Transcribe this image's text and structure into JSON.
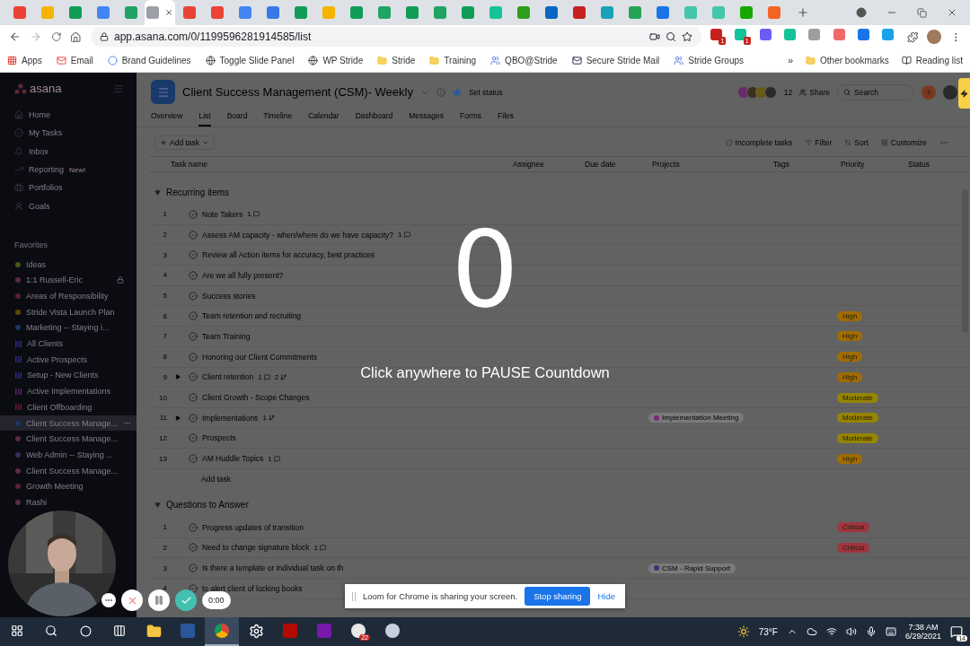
{
  "browser": {
    "tabs": [
      {
        "color": "#ea4335",
        "selected": false
      },
      {
        "color": "#f4b400",
        "selected": false
      },
      {
        "color": "#0f9d58",
        "selected": false
      },
      {
        "color": "#4285f4",
        "selected": false
      },
      {
        "color": "#1ea362",
        "selected": false
      },
      {
        "color": "#9aa0a6",
        "selected": true
      },
      {
        "color": "#ea4335",
        "selected": false
      },
      {
        "color": "#ea4335",
        "selected": false
      },
      {
        "color": "#4285f4",
        "selected": false
      },
      {
        "color": "#3b78e7",
        "selected": false
      },
      {
        "color": "#0f9d58",
        "selected": false
      },
      {
        "color": "#f4b400",
        "selected": false
      },
      {
        "color": "#0f9d58",
        "selected": false
      },
      {
        "color": "#1fa463",
        "selected": false
      },
      {
        "color": "#0f9d58",
        "selected": false
      },
      {
        "color": "#1fa463",
        "selected": false
      },
      {
        "color": "#0f9d58",
        "selected": false
      },
      {
        "color": "#15c39a",
        "selected": false
      },
      {
        "color": "#2ca01c",
        "selected": false
      },
      {
        "color": "#0a66c2",
        "selected": false
      },
      {
        "color": "#c5221f",
        "selected": false
      },
      {
        "color": "#1aa3b8",
        "selected": false
      },
      {
        "color": "#23a455",
        "selected": false
      },
      {
        "color": "#1a73e8",
        "selected": false
      },
      {
        "color": "#43c6ac",
        "selected": false
      },
      {
        "color": "#43c6ac",
        "selected": false
      },
      {
        "color": "#14a800",
        "selected": false
      },
      {
        "color": "#f26522",
        "selected": false
      }
    ],
    "url": "app.asana.com/0/1199596281914585/list",
    "extensions": [
      {
        "color": "#c5221f",
        "badge": "1"
      },
      {
        "color": "#15c39a",
        "badge": "1"
      },
      {
        "color": "#6b5cf5"
      },
      {
        "color": "#15c39a"
      },
      {
        "color": "#9e9e9e"
      },
      {
        "color": "#f06a6a"
      },
      {
        "color": "#1a73e8"
      },
      {
        "color": "#1aa3e8"
      }
    ],
    "bookmarks": [
      {
        "label": "Apps",
        "kind": "apps"
      },
      {
        "label": "Email",
        "kind": "gmail"
      },
      {
        "label": "Brand Guidelines",
        "kind": "google"
      },
      {
        "label": "Toggle Slide Panel",
        "kind": "globe"
      },
      {
        "label": "WP Stride",
        "kind": "globe"
      },
      {
        "label": "Stride",
        "kind": "folder"
      },
      {
        "label": "Training",
        "kind": "folder"
      },
      {
        "label": "QBO@Stride",
        "kind": "groups"
      },
      {
        "label": "Secure Stride Mail",
        "kind": "mail"
      },
      {
        "label": "Stride Groups",
        "kind": "groups"
      }
    ],
    "overflow": "»",
    "other_bookmarks": "Other bookmarks",
    "reading_list": "Reading list"
  },
  "sidebar": {
    "logo": "asana",
    "nav": [
      {
        "label": "Home",
        "kind": "home"
      },
      {
        "label": "My Tasks",
        "kind": "tasks"
      },
      {
        "label": "Inbox",
        "kind": "inbox"
      },
      {
        "label": "Reporting",
        "kind": "reporting",
        "badge": "New!"
      },
      {
        "label": "Portfolios",
        "kind": "portfolios"
      },
      {
        "label": "Goals",
        "kind": "goals"
      }
    ],
    "favorites_title": "Favorites",
    "projects": [
      {
        "label": "Ideas",
        "kind": "dot",
        "color": "#3f5a1c",
        "selected": false,
        "locked": false
      },
      {
        "label": "1:1 Russell-Eric",
        "kind": "dot",
        "color": "#5a2a4a",
        "selected": false,
        "locked": true
      },
      {
        "label": "Areas of Responsibility",
        "kind": "dot",
        "color": "#5a2035",
        "selected": false,
        "locked": false
      },
      {
        "label": "Stride Vista Launch Plan",
        "kind": "dot",
        "color": "#5a4a10",
        "selected": false,
        "locked": false
      },
      {
        "label": "Marketing -- Staying i...",
        "kind": "dot",
        "color": "#1a3560",
        "selected": false,
        "locked": false
      },
      {
        "label": "All Clients",
        "kind": "bars",
        "color": "#2a3070",
        "selected": false,
        "locked": false
      },
      {
        "label": "Active Prospects",
        "kind": "bars",
        "color": "#2a3070",
        "selected": false,
        "locked": false
      },
      {
        "label": "Setup - New Clients",
        "kind": "bars",
        "color": "#2a3070",
        "selected": false,
        "locked": false
      },
      {
        "label": "Active Implementations",
        "kind": "bars",
        "color": "#4a2a5a",
        "selected": false,
        "locked": false
      },
      {
        "label": "Client Offboarding",
        "kind": "bars",
        "color": "#5a2030",
        "selected": false,
        "locked": false
      },
      {
        "label": "Client Success Manage...",
        "kind": "dot",
        "color": "#1a3560",
        "selected": true,
        "locked": false
      },
      {
        "label": "Client Success Manage...",
        "kind": "dot",
        "color": "#5a2a4a",
        "selected": false,
        "locked": false
      },
      {
        "label": "Web Admin -- Staying ...",
        "kind": "dot",
        "color": "#3a2a5a",
        "selected": false,
        "locked": false
      },
      {
        "label": "Client Success Manage...",
        "kind": "dot",
        "color": "#5a2a4a",
        "selected": false,
        "locked": false
      },
      {
        "label": "Growth Meeting",
        "kind": "dot",
        "color": "#5a2035",
        "selected": false,
        "locked": false
      },
      {
        "label": "Rashi",
        "kind": "dot",
        "color": "#5a2a4a",
        "selected": false,
        "locked": false
      }
    ]
  },
  "header": {
    "title": "Client Success Management (CSM)- Weekly",
    "set_status": "Set status",
    "member_count": "12",
    "share": "Share",
    "search_placeholder": "Search",
    "members": [
      {
        "color": "#6a2a6a"
      },
      {
        "color": "#3a3020"
      },
      {
        "color": "#6a5a10"
      },
      {
        "color": "#2a2a2a"
      }
    ],
    "tabs": [
      {
        "label": "Overview",
        "selected": false
      },
      {
        "label": "List",
        "selected": true
      },
      {
        "label": "Board",
        "selected": false
      },
      {
        "label": "Timeline",
        "selected": false
      },
      {
        "label": "Calendar",
        "selected": false
      },
      {
        "label": "Dashboard",
        "selected": false
      },
      {
        "label": "Messages",
        "selected": false
      },
      {
        "label": "Forms",
        "selected": false
      },
      {
        "label": "Files",
        "selected": false
      }
    ]
  },
  "toolbar": {
    "add_task": "Add task",
    "actions": [
      {
        "label": "Incomplete tasks",
        "kind": "check"
      },
      {
        "label": "Filter",
        "kind": "filter"
      },
      {
        "label": "Sort",
        "kind": "sort"
      },
      {
        "label": "Customize",
        "kind": "customize"
      }
    ]
  },
  "columns": [
    "Task name",
    "Assignee",
    "Due date",
    "Projects",
    "Tags",
    "Priority",
    "Status"
  ],
  "sections": [
    {
      "title": "Recurring items",
      "add_task": "Add task",
      "tasks": [
        {
          "number": "1",
          "name": "Note Takers",
          "expandable": false,
          "completed": false,
          "comments": "1"
        },
        {
          "number": "2",
          "name": "Assess AM capacity - when/where do we have capacity?",
          "expandable": false,
          "completed": false,
          "comments": "1"
        },
        {
          "number": "3",
          "name": "Review all Action items for accuracy, best practices",
          "expandable": false,
          "completed": false
        },
        {
          "number": "4",
          "name": "Are we all fully present?",
          "expandable": false,
          "completed": false
        },
        {
          "number": "5",
          "name": "Success stories",
          "expandable": false,
          "completed": false
        },
        {
          "number": "6",
          "name": "Team retention and recruiting",
          "expandable": false,
          "completed": false,
          "priority": {
            "label": "High",
            "color": "#a06c00"
          }
        },
        {
          "number": "7",
          "name": "Team Training",
          "expandable": false,
          "completed": false,
          "priority": {
            "label": "High",
            "color": "#a06c00"
          }
        },
        {
          "number": "8",
          "name": "Honoring our Client Commitments",
          "expandable": false,
          "completed": false,
          "priority": {
            "label": "High",
            "color": "#a06c00"
          }
        },
        {
          "number": "9",
          "name": "Client retention",
          "expandable": true,
          "completed": false,
          "comments": "1",
          "subtasks": "2",
          "priority": {
            "label": "High",
            "color": "#a06c00"
          }
        },
        {
          "number": "10",
          "name": "Client Growth - Scope Changes",
          "expandable": false,
          "completed": false,
          "priority": {
            "label": "Moderate",
            "color": "#948400"
          }
        },
        {
          "number": "11",
          "name": "Implementations",
          "expandable": true,
          "completed": false,
          "subtasks": "1",
          "project": {
            "label": "Implementation Meeting",
            "color": "#7a2a7a"
          },
          "priority": {
            "label": "Moderate",
            "color": "#948400"
          }
        },
        {
          "number": "12",
          "name": "Prospects",
          "expandable": false,
          "completed": false,
          "priority": {
            "label": "Moderate",
            "color": "#948400"
          }
        },
        {
          "number": "13",
          "name": "AM Huddle Topics",
          "expandable": false,
          "completed": false,
          "comments": "1",
          "priority": {
            "label": "High",
            "color": "#a06c00"
          }
        }
      ]
    },
    {
      "title": "Questions to Answer",
      "tasks": [
        {
          "number": "1",
          "name": "Progress updates of transition",
          "expandable": false,
          "completed": false,
          "priority": {
            "label": "Critical",
            "color": "#a03440"
          }
        },
        {
          "number": "2",
          "name": "Need to change signature block",
          "expandable": false,
          "completed": false,
          "comments": "1",
          "priority": {
            "label": "Critical",
            "color": "#a03440"
          }
        },
        {
          "number": "3",
          "name": "Is there a template or individual task on th",
          "expandable": false,
          "completed": false,
          "project": {
            "label": "CSM - Rapid Support",
            "color": "#4a2a7a"
          }
        },
        {
          "number": "4",
          "name": "to alert client of locking books",
          "expandable": false,
          "completed": false
        }
      ]
    }
  ],
  "countdown": {
    "count": "0",
    "message": "Click anywhere to PAUSE Countdown"
  },
  "loom": {
    "timer": "0:00",
    "message": "Loom for Chrome is sharing your screen.",
    "stop": "Stop sharing",
    "hide": "Hide"
  },
  "taskbar": {
    "apps": [
      {
        "kind": "explorer",
        "selected": false
      },
      {
        "kind": "word",
        "selected": false
      },
      {
        "kind": "chrome",
        "selected": true
      },
      {
        "kind": "settings",
        "selected": false
      },
      {
        "kind": "acrobat",
        "selected": false
      },
      {
        "kind": "onenote",
        "selected": false
      },
      {
        "kind": "slack",
        "selected": false,
        "badge": "22"
      },
      {
        "kind": "snip",
        "selected": false
      }
    ],
    "temperature": "73°F",
    "time": "7:38 AM",
    "date": "6/29/2021",
    "notifications": "14"
  }
}
